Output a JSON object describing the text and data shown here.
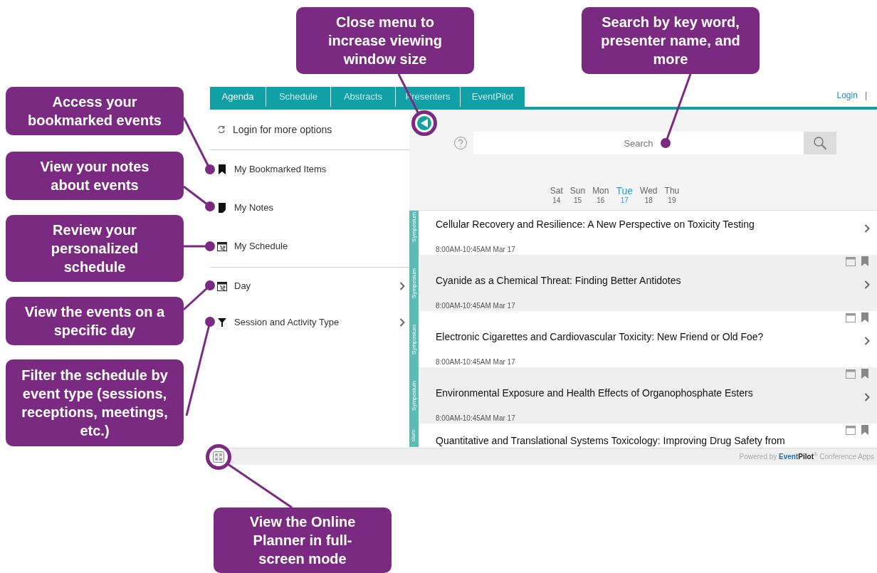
{
  "annotations": [
    {
      "text": "Access your bookmarked events"
    },
    {
      "text": "View your notes about events"
    },
    {
      "text": "Review your personalized schedule"
    },
    {
      "text": "View the events on a specific day"
    },
    {
      "text": "Filter the schedule by event type (sessions, receptions, meetings, etc.)"
    },
    {
      "text": "Close menu to increase viewing window size"
    },
    {
      "text": "Search by key word, presenter name, and more"
    },
    {
      "text": "View the Online Planner in full-screen mode"
    }
  ],
  "tabs": [
    {
      "label": "Agenda",
      "selected": true
    },
    {
      "label": "Schedule",
      "selected": false
    },
    {
      "label": "Abstracts",
      "selected": false
    },
    {
      "label": "Presenters",
      "selected": false
    },
    {
      "label": "EventPilot",
      "selected": false
    }
  ],
  "login_link": "Login",
  "separator": "|",
  "menu": {
    "login_prompt": "Login for more options",
    "sections": [
      [
        {
          "label": "My Bookmarked Items",
          "kind": "bookmark",
          "submenu": false
        },
        {
          "label": "My Notes",
          "kind": "note",
          "submenu": false
        },
        {
          "label": "My Schedule",
          "kind": "calendar",
          "submenu": false
        }
      ],
      [
        {
          "label": "Day",
          "kind": "calendar",
          "submenu": true
        },
        {
          "label": "Session and Activity Type",
          "kind": "filter",
          "submenu": true
        }
      ]
    ]
  },
  "search": {
    "placeholder": "Search"
  },
  "days": [
    {
      "day": "Sat",
      "date": "14",
      "selected": false
    },
    {
      "day": "Sun",
      "date": "15",
      "selected": false
    },
    {
      "day": "Mon",
      "date": "16",
      "selected": false
    },
    {
      "day": "Tue",
      "date": "17",
      "selected": true
    },
    {
      "day": "Wed",
      "date": "18",
      "selected": false
    },
    {
      "day": "Thu",
      "date": "19",
      "selected": false
    }
  ],
  "sessions": [
    {
      "track": "Symposium",
      "title": "Cellular Recovery and Resilience: A New Perspective on Toxicity Testing",
      "time": "8:00AM-10:45AM Mar 17"
    },
    {
      "track": "Symposium",
      "title": "Cyanide as a Chemical Threat: Finding Better Antidotes",
      "time": "8:00AM-10:45AM Mar 17"
    },
    {
      "track": "Symposium",
      "title": "Electronic Cigarettes and Cardiovascular Toxicity: New Friend or Old Foe?",
      "time": "8:00AM-10:45AM Mar 17"
    },
    {
      "track": "Symposium",
      "title": "Environmental Exposure and Health Effects of Organophosphate Esters",
      "time": "8:00AM-10:45AM Mar 17"
    },
    {
      "track": "sium",
      "title": "Quantitative and Translational Systems Toxicology: Improving Drug Safety from"
    }
  ],
  "footer": {
    "prefix": "Powered by",
    "brand_first": "Event",
    "brand_second": "Pilot",
    "mark": "®",
    "suffix": "Conference Apps"
  }
}
